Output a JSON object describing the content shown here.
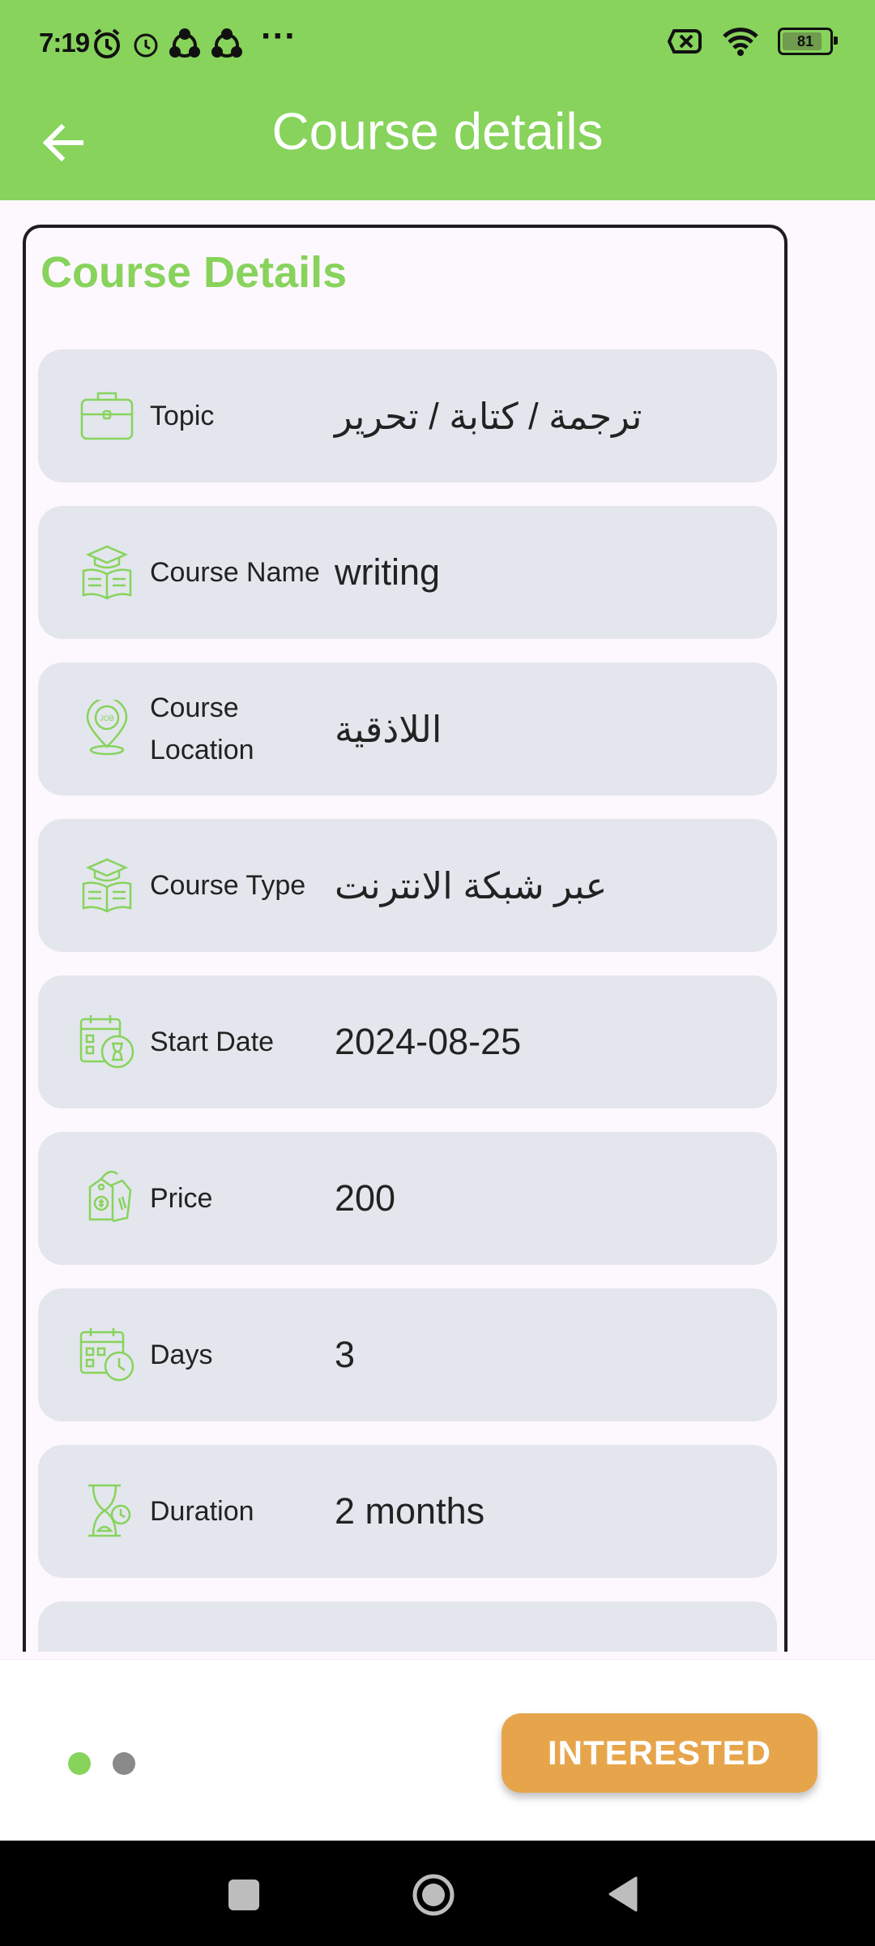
{
  "status_bar": {
    "time": "7:19",
    "battery": "81",
    "overflow": "···"
  },
  "app_bar": {
    "title": "Course details",
    "back_icon": "arrow-left-icon"
  },
  "card": {
    "title": "Course Details",
    "rows": [
      {
        "label": "Topic",
        "value": "ترجمة / كتابة / تحرير",
        "icon": "briefcase-icon"
      },
      {
        "label": "Course Name",
        "value": "writing",
        "icon": "graduation-book-icon"
      },
      {
        "label": "Course Location",
        "value": "اللاذقية",
        "icon": "location-pin-icon"
      },
      {
        "label": "Course Type",
        "value": "عبر شبكة الانترنت",
        "icon": "graduation-book-icon"
      },
      {
        "label": "Start Date",
        "value": "2024-08-25",
        "icon": "calendar-hourglass-icon"
      },
      {
        "label": "Price",
        "value": "200",
        "icon": "price-tag-icon"
      },
      {
        "label": "Days",
        "value": "3",
        "icon": "calendar-clock-icon"
      },
      {
        "label": "Duration",
        "value": "2 months",
        "icon": "hourglass-icon"
      }
    ]
  },
  "bottom": {
    "button_label": "INTERESTED",
    "page_indicator": {
      "current": 1,
      "total": 2
    }
  },
  "colors": {
    "primary": "#87d35c",
    "accent": "#e7a54b",
    "row_bg": "#e3e6ec"
  }
}
